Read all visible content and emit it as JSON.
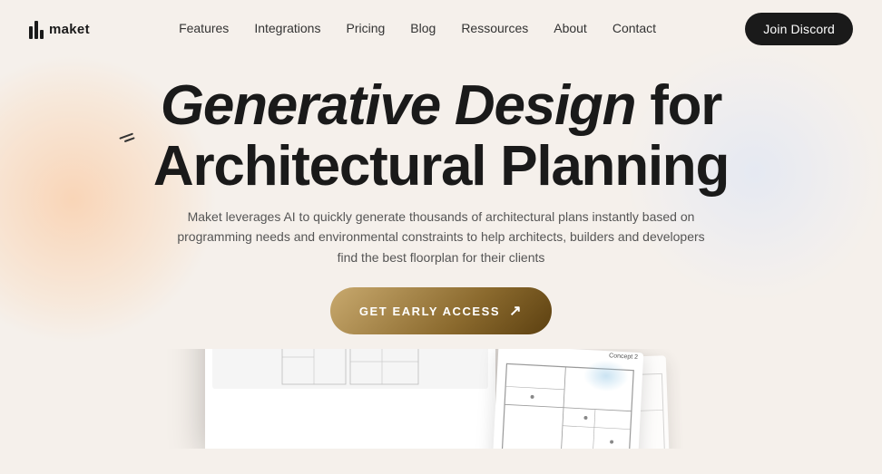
{
  "brand": {
    "name": "maket",
    "logo_bars": [
      14,
      20,
      10
    ]
  },
  "nav": {
    "links": [
      {
        "label": "Features",
        "href": "#"
      },
      {
        "label": "Integrations",
        "href": "#"
      },
      {
        "label": "Pricing",
        "href": "#"
      },
      {
        "label": "Blog",
        "href": "#"
      },
      {
        "label": "Ressources",
        "href": "#"
      },
      {
        "label": "About",
        "href": "#"
      },
      {
        "label": "Contact",
        "href": "#"
      }
    ],
    "cta": "Join Discord"
  },
  "hero": {
    "title_italic": "Generative Design",
    "title_rest": " for\nArchitectural Planning",
    "subtitle": "Maket leverages AI to quickly generate thousands of architectural plans instantly based on programming needs and environmental constraints to help architects, builders and developers find the best floorplan for their clients",
    "cta_label": "GET EARLY ACCESS",
    "cta_arrow": "↗"
  },
  "preview": {
    "concept_label": "Concept 2"
  }
}
